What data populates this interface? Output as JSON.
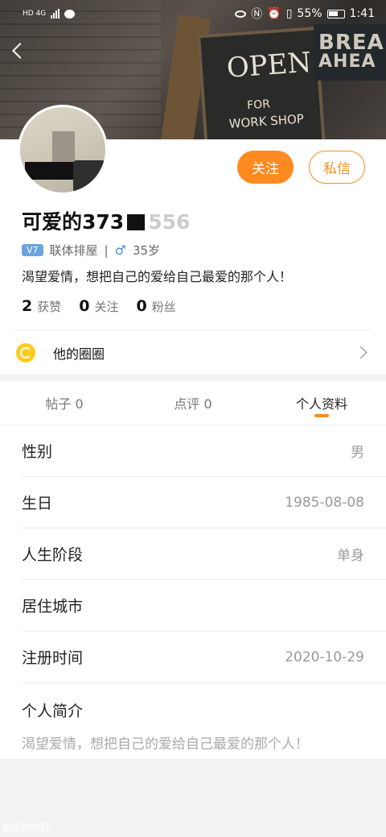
{
  "status_bar": {
    "left_label": "HD 4G",
    "battery_percent": "55%",
    "time": "1:41"
  },
  "cover": {
    "board_line1": "OPEN",
    "board_line2": "FOR",
    "board_line3": "WORK SHOP",
    "sign_line1": "BREA",
    "sign_line2": "AHEA"
  },
  "profile": {
    "follow_label": "关注",
    "message_label": "私信",
    "username_prefix": "可爱的373",
    "username_suffix": "556",
    "level_badge": "V7",
    "community": "联体排屋",
    "gender_symbol": "♂",
    "age": "35岁",
    "bio": "渴望爱情，想把自己的爱给自己最爱的那个人！",
    "stats": [
      {
        "value": "2",
        "label": "获赞"
      },
      {
        "value": "0",
        "label": "关注"
      },
      {
        "value": "0",
        "label": "粉丝"
      }
    ],
    "circle_label": "他的圈圈"
  },
  "tabs": [
    {
      "label": "帖子 0"
    },
    {
      "label": "点评 0"
    },
    {
      "label": "个人资料"
    }
  ],
  "active_tab": 2,
  "info": {
    "rows": [
      {
        "label": "性别",
        "value": "男"
      },
      {
        "label": "生日",
        "value": "1985-08-08"
      },
      {
        "label": "人生阶段",
        "value": "单身"
      },
      {
        "label": "居住城市",
        "value": ""
      },
      {
        "label": "注册时间",
        "value": "2020-10-29"
      }
    ],
    "intro_label": "个人简介",
    "intro_text": "渴望爱情，想把自己的爱给自己最爱的那个人！"
  },
  "watermark": "重庆购物狂",
  "colors": {
    "accent": "#ff8a1f",
    "badge_blue": "#6aa2e0",
    "circle_icon": "#ffcb1f"
  }
}
